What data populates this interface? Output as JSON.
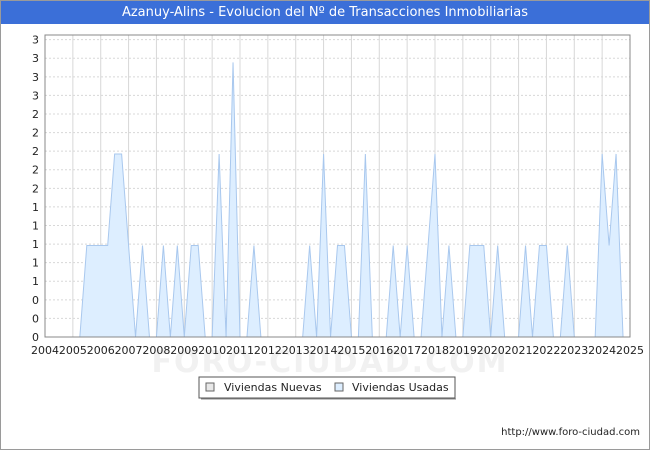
{
  "title": "Azanuy-Alins - Evolucion del Nº de Transacciones Inmobiliarias",
  "credit": "http://www.foro-ciudad.com",
  "watermark": "FORO-CIUDAD.COM",
  "colors": {
    "title_bg": "#3b6fd8",
    "nuevas": "#e8e8e8",
    "usadas": "#ddeeff",
    "usadas_line": "#a9c8ee",
    "grid": "#d8d8d8"
  },
  "chart_data": {
    "type": "area",
    "title": "Azanuy-Alins - Evolucion del Nº de Transacciones Inmobiliarias",
    "xlabel": "",
    "ylabel": "",
    "xlim": [
      2004,
      2025
    ],
    "ylim": [
      0,
      3.3
    ],
    "grid": true,
    "legend": "bottom-center",
    "x_ticks": [
      "2004",
      "2005",
      "2006",
      "2007",
      "2008",
      "2009",
      "2010",
      "2011",
      "2012",
      "2013",
      "2014",
      "2015",
      "2016",
      "2017",
      "2018",
      "2019",
      "2020",
      "2021",
      "2022",
      "2023",
      "2024",
      "2025"
    ],
    "y_ticks": [
      "0",
      "0",
      "0",
      "1",
      "1",
      "1",
      "1",
      "1",
      "2",
      "2",
      "2",
      "2",
      "2",
      "3",
      "3",
      "3",
      "3"
    ],
    "series": [
      {
        "name": "Viviendas Nuevas",
        "x": [],
        "y": []
      },
      {
        "name": "Viviendas Usadas",
        "x": [
          2004.0,
          2004.25,
          2004.5,
          2004.75,
          2005.0,
          2005.25,
          2005.5,
          2005.75,
          2006.0,
          2006.25,
          2006.5,
          2006.75,
          2007.0,
          2007.25,
          2007.5,
          2007.75,
          2008.0,
          2008.25,
          2008.5,
          2008.75,
          2009.0,
          2009.25,
          2009.5,
          2009.75,
          2010.0,
          2010.25,
          2010.5,
          2010.75,
          2011.0,
          2011.25,
          2011.5,
          2011.75,
          2012.0,
          2012.25,
          2012.5,
          2012.75,
          2013.0,
          2013.25,
          2013.5,
          2013.75,
          2014.0,
          2014.25,
          2014.5,
          2014.75,
          2015.0,
          2015.25,
          2015.5,
          2015.75,
          2016.0,
          2016.25,
          2016.5,
          2016.75,
          2017.0,
          2017.25,
          2017.5,
          2017.75,
          2018.0,
          2018.25,
          2018.5,
          2018.75,
          2019.0,
          2019.25,
          2019.5,
          2019.75,
          2020.0,
          2020.25,
          2020.5,
          2020.75,
          2021.0,
          2021.25,
          2021.5,
          2021.75,
          2022.0,
          2022.25,
          2022.5,
          2022.75,
          2023.0,
          2023.25,
          2023.5,
          2023.75,
          2024.0,
          2024.25,
          2024.5,
          2024.75,
          2025.0
        ],
        "y": [
          0,
          0,
          0,
          0,
          0,
          0,
          1,
          1,
          1,
          1,
          2,
          2,
          1,
          0,
          1,
          0,
          0,
          1,
          0,
          1,
          0,
          1,
          1,
          0,
          0,
          2,
          0,
          3,
          0,
          0,
          1,
          0,
          0,
          0,
          0,
          0,
          0,
          0,
          1,
          0,
          2,
          0,
          1,
          1,
          0,
          0,
          2,
          0,
          0,
          0,
          1,
          0,
          1,
          0,
          0,
          1,
          2,
          0,
          1,
          0,
          0,
          1,
          1,
          1,
          0,
          1,
          0,
          0,
          0,
          1,
          0,
          1,
          1,
          0,
          0,
          1,
          0,
          0,
          0,
          0,
          2,
          1,
          2,
          0,
          0
        ]
      }
    ]
  }
}
